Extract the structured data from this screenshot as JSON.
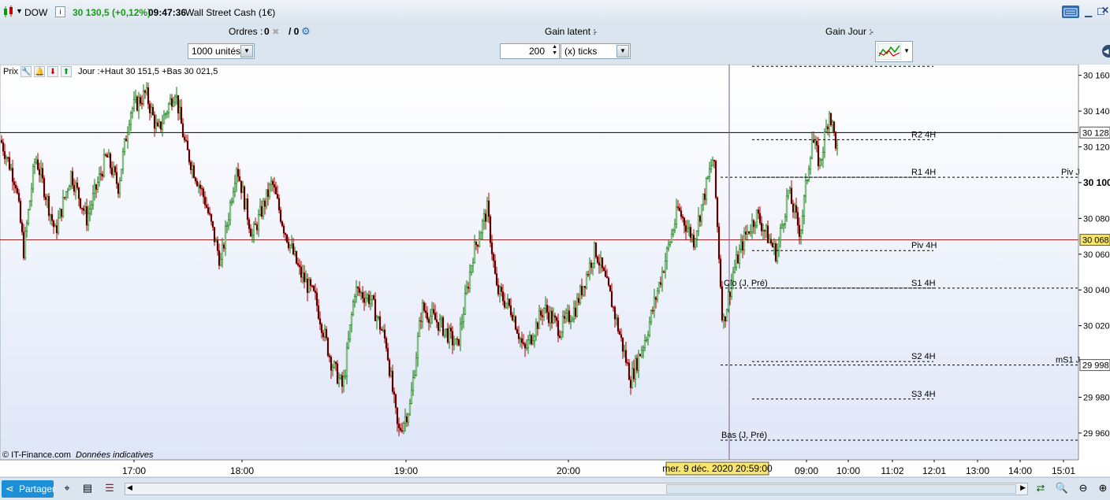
{
  "titlebar": {
    "symbol": "DOW",
    "price": "30 130,5 (+0,12%)",
    "time": "09:47:36",
    "instrument": "Wall Street Cash (1€)"
  },
  "infobar": {
    "orders_label": "Ordres :",
    "orders_value1": "0",
    "orders_sep": "/ 0",
    "latent_label": "Gain latent :",
    "latent_value": "-",
    "day_label": "Gain Jour :",
    "day_value": "-"
  },
  "controls": {
    "units": "1000 unités",
    "ticks_value": "200",
    "ticks_label": "(x) ticks"
  },
  "legend": {
    "prix": "Prix",
    "label": "Jour :+Haut 30 151,5 +Bas 30 021,5"
  },
  "footer_note": {
    "copyright": "© IT-Finance.com",
    "note": "Données indicatives"
  },
  "bottom": {
    "share": "Partager"
  },
  "colors": {
    "up": "#0a7d0a",
    "down": "#b00000",
    "bg_top": "#ffffff",
    "bg_bottom": "#dfe6f7"
  },
  "chart_data": {
    "type": "candlestick",
    "ylim": [
      29945,
      30166
    ],
    "y_ticks": [
      "30 160",
      "30 140",
      "30 120",
      "30 100",
      "30 080",
      "30 060",
      "30 040",
      "30 020",
      "29 980",
      "29 960"
    ],
    "y_tick_values": [
      30160,
      30140,
      30120,
      30100,
      30080,
      30060,
      30040,
      30020,
      29980,
      29960
    ],
    "x_ticks": [
      "17:00",
      "18:00",
      "19:00",
      "20:00",
      "09:00",
      "10:00",
      "11:02",
      "12:01",
      "13:00",
      "14:00",
      "15:01"
    ],
    "x_tick_index": [
      170,
      307,
      515,
      721,
      1023,
      1076,
      1132,
      1185,
      1240,
      1294,
      1349
    ],
    "current_price": 30128,
    "current_price_label": "30 128",
    "highlight_price_label": "30 068",
    "highlight_price": 30068,
    "ms1_label": "29 998",
    "ms1_price": 29998,
    "cursor_date": "mer. 9 déc. 2020 20:59:00",
    "pivot_levels": [
      {
        "name": "R2 4H",
        "value": 30124
      },
      {
        "name": "R1 4H",
        "value": 30103
      },
      {
        "name": "Piv 4H",
        "value": 30062
      },
      {
        "name": "S1 4H",
        "value": 30041
      },
      {
        "name": "S2 4H",
        "value": 30000
      },
      {
        "name": "S3 4H",
        "value": 29979
      }
    ],
    "day_levels": [
      {
        "name": "Piv J",
        "value": 30103
      },
      {
        "name": "mS1 J",
        "value": 29998
      },
      {
        "name": "Bas (J, Pré)",
        "value": 29956
      },
      {
        "name": "Clo (J, Pré)",
        "value": 30041
      }
    ],
    "top_dashed": 30165,
    "price_path": [
      [
        0,
        30125
      ],
      [
        20,
        30100
      ],
      [
        30,
        30062
      ],
      [
        45,
        30115
      ],
      [
        60,
        30090
      ],
      [
        70,
        30072
      ],
      [
        90,
        30105
      ],
      [
        110,
        30080
      ],
      [
        135,
        30115
      ],
      [
        150,
        30098
      ],
      [
        165,
        30140
      ],
      [
        185,
        30150
      ],
      [
        200,
        30128
      ],
      [
        222,
        30152
      ],
      [
        235,
        30120
      ],
      [
        260,
        30090
      ],
      [
        280,
        30055
      ],
      [
        300,
        30110
      ],
      [
        320,
        30070
      ],
      [
        345,
        30100
      ],
      [
        360,
        30075
      ],
      [
        380,
        30050
      ],
      [
        400,
        30035
      ],
      [
        420,
        30000
      ],
      [
        435,
        29985
      ],
      [
        450,
        30040
      ],
      [
        470,
        30035
      ],
      [
        490,
        30010
      ],
      [
        505,
        29960
      ],
      [
        520,
        29975
      ],
      [
        535,
        30030
      ],
      [
        560,
        30020
      ],
      [
        580,
        30008
      ],
      [
        600,
        30060
      ],
      [
        618,
        30085
      ],
      [
        630,
        30040
      ],
      [
        650,
        30028
      ],
      [
        665,
        30005
      ],
      [
        690,
        30030
      ],
      [
        710,
        30018
      ],
      [
        730,
        30030
      ],
      [
        755,
        30063
      ],
      [
        775,
        30035
      ],
      [
        800,
        29990
      ],
      [
        820,
        30015
      ],
      [
        840,
        30050
      ],
      [
        860,
        30085
      ],
      [
        880,
        30068
      ],
      [
        905,
        30115
      ],
      [
        917,
        30020
      ],
      [
        930,
        30050
      ],
      [
        945,
        30070
      ],
      [
        960,
        30082
      ],
      [
        985,
        30060
      ],
      [
        1000,
        30095
      ],
      [
        1015,
        30072
      ],
      [
        1030,
        30125
      ],
      [
        1040,
        30110
      ],
      [
        1052,
        30140
      ],
      [
        1062,
        30118
      ]
    ]
  }
}
